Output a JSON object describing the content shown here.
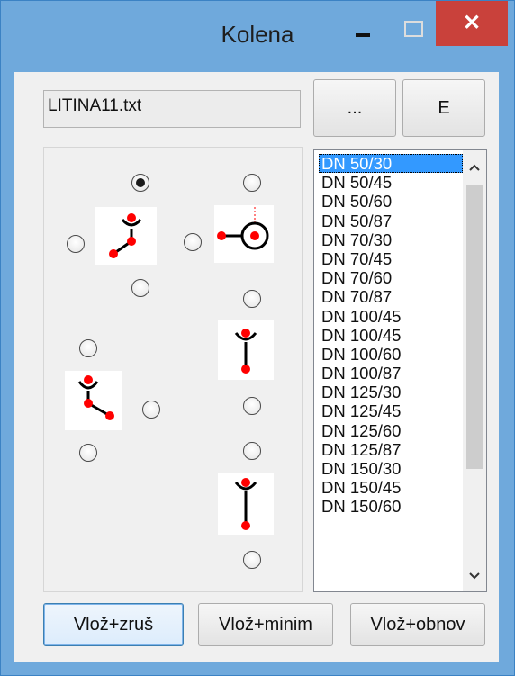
{
  "window": {
    "title": "Kolena",
    "minimize_glyph": "–",
    "maximize_glyph": "☐",
    "close_glyph": "✕"
  },
  "file": {
    "name": "LITINA11.txt"
  },
  "top_buttons": {
    "browse_label": "...",
    "e_label": "E"
  },
  "options": {
    "selected": "radio-a-top"
  },
  "symbols": {
    "accent_color": "#ff0000",
    "line_color": "#000000"
  },
  "list": {
    "items": [
      "DN 50/30",
      "DN 50/45",
      "DN 50/60",
      "DN 50/87",
      "DN 70/30",
      "DN 70/45",
      "DN 70/60",
      "DN 70/87",
      "DN 100/45",
      "DN 100/45",
      "DN 100/60",
      "DN 100/87",
      "DN 125/30",
      "DN 125/45",
      "DN 125/60",
      "DN 125/87",
      "DN 150/30",
      "DN 150/45",
      "DN 150/60"
    ],
    "selected_index": 0
  },
  "bottom_buttons": {
    "insert_close_label": "Vlož+zruš",
    "insert_minimize_label": "Vlož+minim",
    "insert_restore_label": "Vlož+obnov"
  }
}
